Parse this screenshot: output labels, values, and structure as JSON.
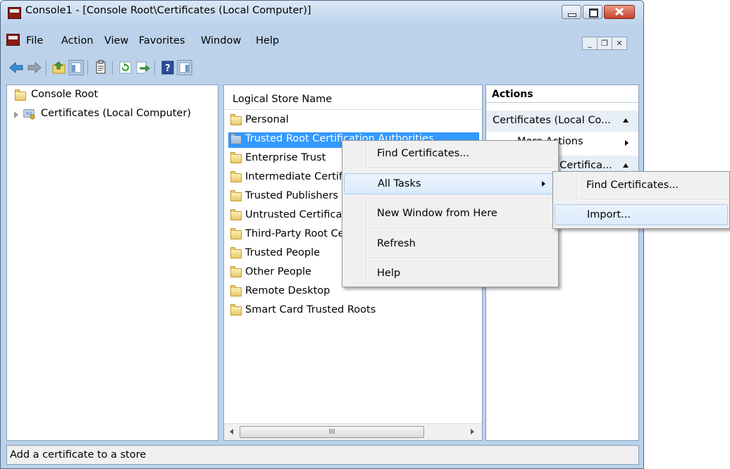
{
  "window": {
    "title": "Console1 - [Console Root\\Certificates (Local Computer)]"
  },
  "menubar": {
    "items": [
      "File",
      "Action",
      "View",
      "Favorites",
      "Window",
      "Help"
    ]
  },
  "toolbar": {
    "buttons": [
      "back-icon",
      "forward-icon",
      "up-folder-icon",
      "show-hide-tree-icon",
      "properties-icon",
      "refresh-icon",
      "export-list-icon",
      "help-icon",
      "show-hide-action-pane-icon"
    ]
  },
  "tree": {
    "root": "Console Root",
    "child": "Certificates (Local Computer)"
  },
  "list": {
    "header": "Logical Store Name",
    "items": [
      "Personal",
      "Trusted Root Certification Authorities",
      "Enterprise Trust",
      "Intermediate Certification Authorities",
      "Trusted Publishers",
      "Untrusted Certificates",
      "Third-Party Root Certification Authorities",
      "Trusted People",
      "Other People",
      "Remote Desktop",
      "Smart Card Trusted Roots"
    ],
    "selected_index": 1,
    "scrollbar_thumb": "III"
  },
  "actions": {
    "header": "Actions",
    "section1": "Certificates (Local Co...",
    "more_actions": "More Actions",
    "section2": "Trusted Root Certifica..."
  },
  "context_menu": {
    "items": [
      "Find Certificates...",
      "All Tasks",
      "New Window from Here",
      "Refresh",
      "Help"
    ],
    "highlighted": "All Tasks"
  },
  "submenu": {
    "items": [
      "Find Certificates...",
      "Import..."
    ],
    "highlighted": "Import..."
  },
  "status": {
    "text": "Add a certificate to a store"
  },
  "colors": {
    "selection": "#3399ff",
    "frame": "#bcd2ea",
    "menu_bg": "#f0f0f0",
    "close_button": "#c5412a"
  }
}
